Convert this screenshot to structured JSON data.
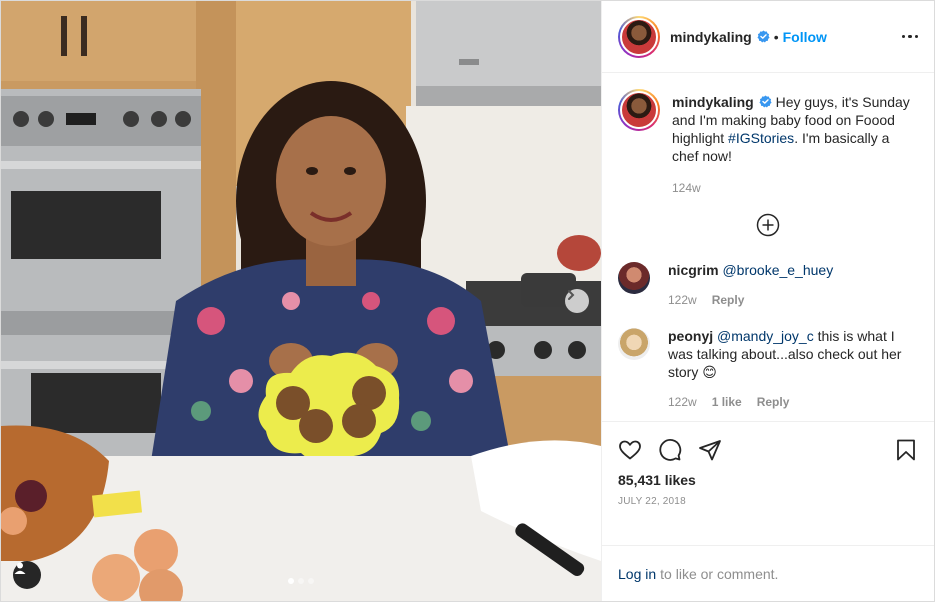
{
  "post": {
    "username": "mindykaling",
    "follow_label": "Follow",
    "separator": "•",
    "caption": {
      "username": "mindykaling",
      "text_before": " Hey guys, it's Sunday and I'm making baby food on Foood highlight ",
      "hashtag": "#IGStories",
      "text_after": ". I'm basically a chef now!",
      "time": "124w"
    },
    "comments": [
      {
        "username": "nicgrim",
        "mention": "@brooke_e_huey",
        "text": "",
        "time": "122w",
        "likes": "",
        "reply": "Reply"
      },
      {
        "username": "peonyj",
        "mention": "@mandy_joy_c",
        "text": " this is what I was talking about...also check out her story 😊",
        "time": "122w",
        "likes": "1 like",
        "reply": "Reply"
      }
    ],
    "likes": "85,431 likes",
    "date": "July 22, 2018",
    "login_link": "Log in",
    "login_text": "to like or comment."
  },
  "colors": {
    "link_blue": "#0095f6",
    "hashtag": "#00376b",
    "muted": "#8e8e8e"
  },
  "icons": [
    "verified-badge-icon",
    "more-options-icon",
    "load-more-comments-icon",
    "heart-icon",
    "comment-icon",
    "share-icon",
    "save-bookmark-icon",
    "carousel-next-icon",
    "user-tag-icon"
  ]
}
